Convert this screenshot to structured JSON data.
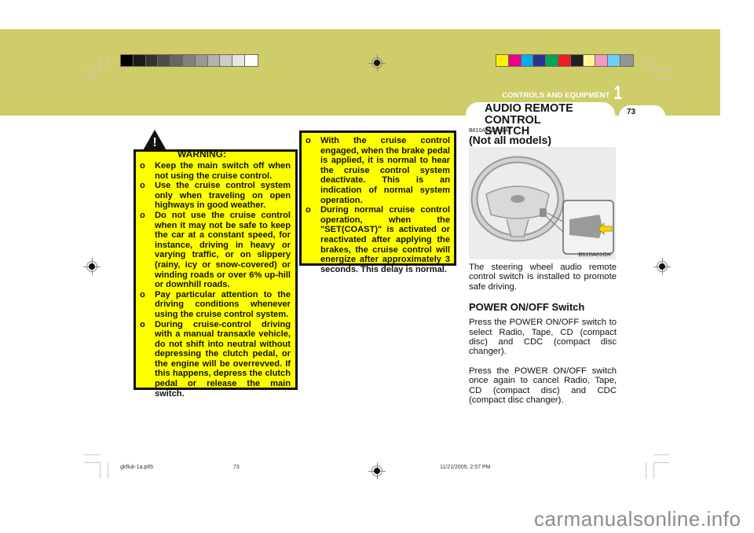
{
  "print_marks": {
    "grayscale_swatches": [
      "#000000",
      "#1a1a1a",
      "#333333",
      "#4d4d4d",
      "#666666",
      "#808080",
      "#999999",
      "#b3b3b3",
      "#cccccc",
      "#e6e6e6",
      "#ffffff"
    ],
    "color_swatches": [
      "#fff200",
      "#ec008c",
      "#00aeef",
      "#2e3192",
      "#00a651",
      "#ed1c24",
      "#231f20",
      "#fff799",
      "#f49ac1",
      "#6dcff6",
      "#939598"
    ],
    "band_color": "#cfcc6a"
  },
  "header": {
    "section_label": "CONTROLS AND EQUIPMENT",
    "section_number": "1",
    "tab_title_line1": "AUDIO REMOTE CONTROL",
    "tab_title_line2": "SWITCH",
    "page_number": "73"
  },
  "warning": {
    "icon": "warning-triangle-icon",
    "icon_glyph": "!",
    "title": "WARNING:",
    "items": [
      "Keep the main switch off when not using the cruise control.",
      "Use the cruise control system only when traveling on open highways in good weather.",
      "Do not use the cruise control when it may not be safe to keep the car at a constant speed, for instance, driving in heavy or varying traffic, or on slippery (rainy, icy or snow-covered) or winding roads or over 6% up-hill or downhill roads.",
      "Pay particular attention to the driving conditions whenever using the cruise control system.",
      "During cruise-control driving with a manual transaxle vehicle, do not shift into neutral without depressing the clutch pedal, or the engine will be overrevved. If this happens, depress the clutch pedal or release the main switch."
    ]
  },
  "note": {
    "items": [
      "With the cruise control engaged, when the brake pedal is applied, it is normal to hear the cruise control system deactivate. This is an indication of normal system operation.",
      "During normal cruise control operation, when the \"SET(COAST)\" is activated or reactivated after applying the brakes, the cruise control will energize after approximately 3 seconds. This delay is normal."
    ]
  },
  "right_column": {
    "ref_code": "B610A01GK-EAT",
    "subheading": "(Not all models)",
    "figure_caption": "B610A01GK",
    "figure_alt": "steering-wheel-audio-remote-illustration",
    "intro": "The steering wheel audio remote control switch is installed to promote safe driving.",
    "section_title": "POWER ON/OFF Switch",
    "paragraphs": [
      "Press the POWER ON/OFF switch to select Radio, Tape, CD (compact disc) and CDC (compact disc changer).",
      "Press the POWER ON/OFF switch once again to cancel Radio, Tape, CD (compact disc) and CDC (compact disc changer)."
    ]
  },
  "footer": {
    "file_name": "gkfluk-1a.p65",
    "page": "73",
    "timestamp": "11/21/2005, 2:57 PM"
  },
  "watermark": "carmanualsonline.info"
}
